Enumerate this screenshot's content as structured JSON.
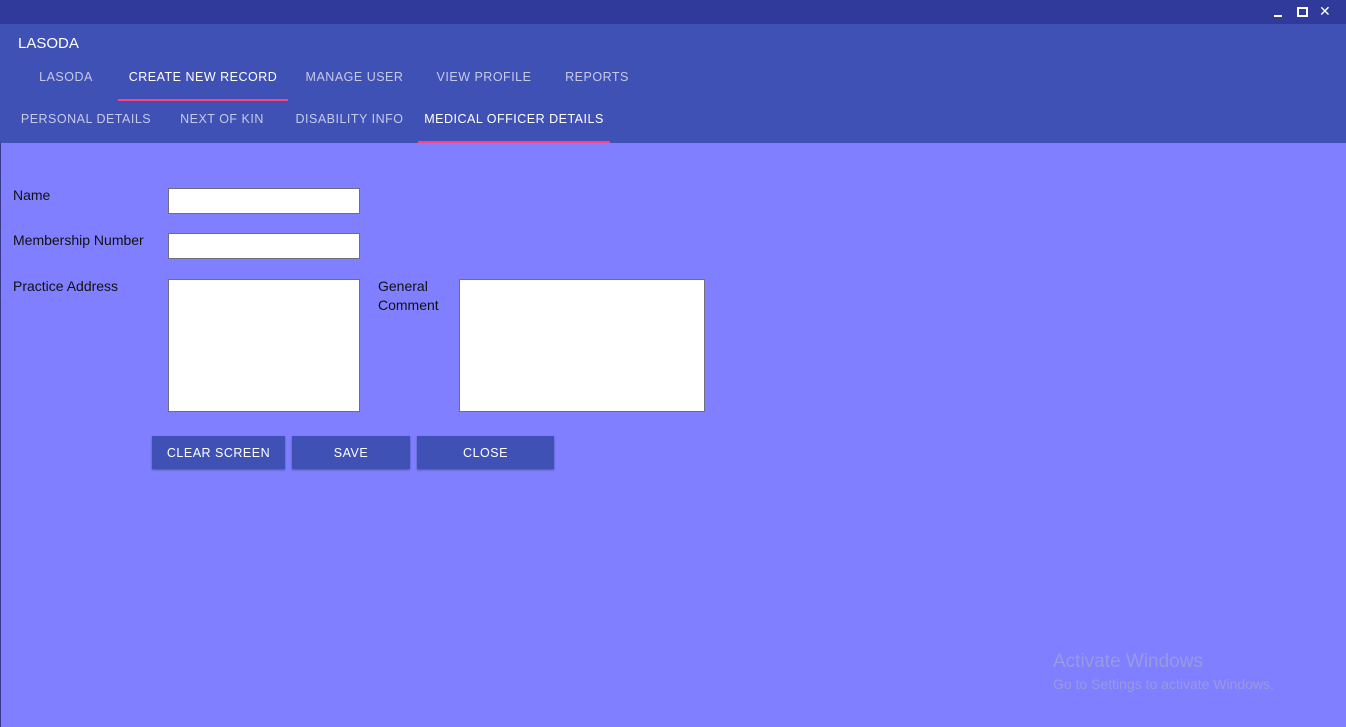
{
  "window": {
    "minimize_icon": "minimize-icon",
    "maximize_icon": "maximize-icon",
    "close_icon": "close-icon",
    "close_glyph": "✕"
  },
  "app": {
    "title": "LASODA"
  },
  "main_tabs": [
    {
      "label": "LASODA",
      "active": false
    },
    {
      "label": "CREATE NEW RECORD",
      "active": true
    },
    {
      "label": "MANAGE USER",
      "active": false
    },
    {
      "label": "VIEW PROFILE",
      "active": false
    },
    {
      "label": "REPORTS",
      "active": false
    }
  ],
  "sub_tabs": [
    {
      "label": "PERSONAL DETAILS",
      "active": false
    },
    {
      "label": "NEXT OF KIN",
      "active": false
    },
    {
      "label": "DISABILITY INFO",
      "active": false
    },
    {
      "label": "MEDICAL OFFICER DETAILS",
      "active": true
    }
  ],
  "form": {
    "name_label": "Name",
    "name_value": "",
    "membership_label": "Membership Number",
    "membership_value": "",
    "practice_address_label": "Practice Address",
    "practice_address_value": "",
    "general_comment_label": "General Comment",
    "general_comment_value": ""
  },
  "buttons": {
    "clear_label": "CLEAR SCREEN",
    "save_label": "SAVE",
    "close_label": "CLOSE"
  },
  "watermark": {
    "title": "Activate Windows",
    "subtitle": "Go to Settings to activate Windows."
  },
  "colors": {
    "header": "#3f51b5",
    "titlebar": "#2f3a9a",
    "background": "#7f7fff",
    "tab_indicator": "#ff4081"
  }
}
